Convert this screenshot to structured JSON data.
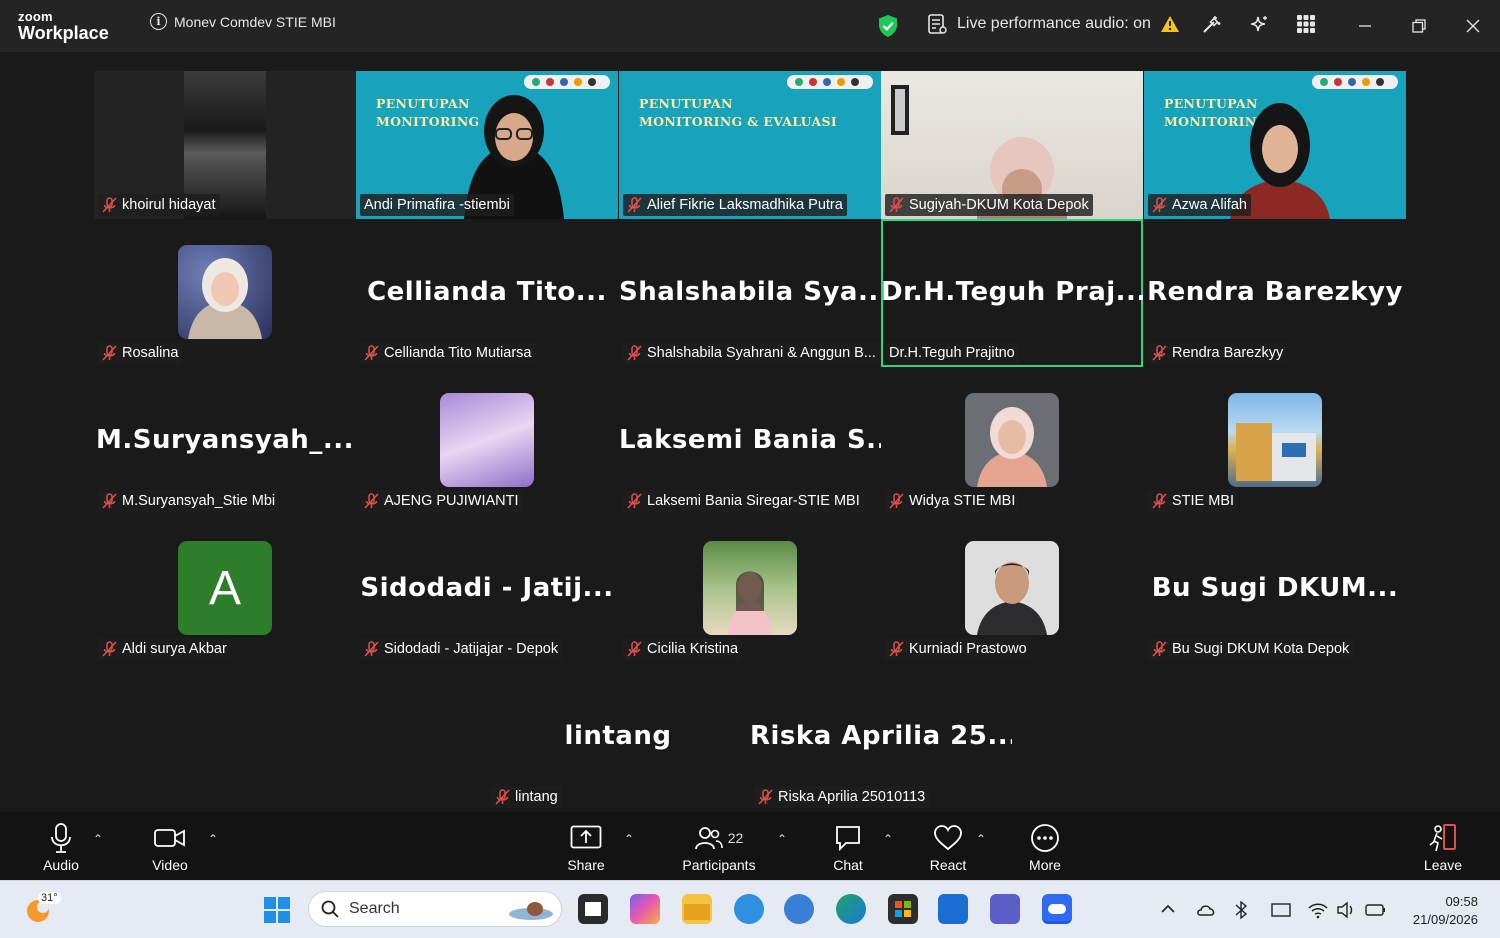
{
  "app": {
    "brand_top": "zoom",
    "brand_bottom": "Workplace",
    "meeting_title": "Monev Comdev STIE MBI"
  },
  "header": {
    "live_audio": "Live performance audio: on"
  },
  "tiles": [
    {
      "name": "khoirul hidayat",
      "big": ""
    },
    {
      "name": "Andi Primafira -stiembi",
      "big": ""
    },
    {
      "name": "Alief Fikrie Laksmadhika Putra",
      "big": ""
    },
    {
      "name": "Sugiyah-DKUM Kota Depok",
      "big": ""
    },
    {
      "name": "Azwa Alifah",
      "big": ""
    },
    {
      "name": "Rosalina",
      "big": ""
    },
    {
      "name": "Cellianda Tito Mutiarsa",
      "big": "Cellianda  Tito..."
    },
    {
      "name": "Shalshabila Syahrani & Anggun B...",
      "big": "Shalshabila  Sya..."
    },
    {
      "name": "Dr.H.Teguh Prajitno",
      "big": "Dr.H.Teguh  Praj..."
    },
    {
      "name": "Rendra Barezkyy",
      "big": "Rendra Barezkyy"
    },
    {
      "name": "M.Suryansyah_Stie Mbi",
      "big": "M.Suryansyah_..."
    },
    {
      "name": "AJENG PUJIWIANTI",
      "big": ""
    },
    {
      "name": "Laksemi Bania Siregar-STIE MBI",
      "big": "Laksemi  Bania  S..."
    },
    {
      "name": "Widya STIE MBI",
      "big": ""
    },
    {
      "name": "STIE MBI",
      "big": ""
    },
    {
      "name": "Aldi surya Akbar",
      "big": "",
      "initial": "A"
    },
    {
      "name": "Sidodadi - Jatijajar - Depok",
      "big": "Sidodadi  -  Jatij..."
    },
    {
      "name": "Cicilia Kristina",
      "big": ""
    },
    {
      "name": "Kurniadi Prastowo",
      "big": ""
    },
    {
      "name": "Bu Sugi DKUM Kota Depok",
      "big": "Bu Sugi  DKUM..."
    },
    {
      "name": "lintang",
      "big": "lintang"
    },
    {
      "name": "Riska Aprilia 25010113",
      "big": "Riska  Aprilia  25..."
    }
  ],
  "banner": {
    "line1": "PENUTUPAN",
    "line2": "MONITORING & EVALUASI",
    "line2_short": "MONITORING &",
    "line2_b": "MONITORING"
  },
  "toolbar": {
    "audio": "Audio",
    "video": "Video",
    "share": "Share",
    "participants": "Participants",
    "participants_count": "22",
    "chat": "Chat",
    "react": "React",
    "more": "More",
    "leave": "Leave"
  },
  "taskbar": {
    "weather": "31°",
    "search_placeholder": "Search",
    "time": "09:58",
    "date": "21/09/2026"
  },
  "colors": {
    "accent_green": "#2fd67a",
    "banner_teal": "#17a3bb",
    "mic_red": "#e0504a"
  }
}
